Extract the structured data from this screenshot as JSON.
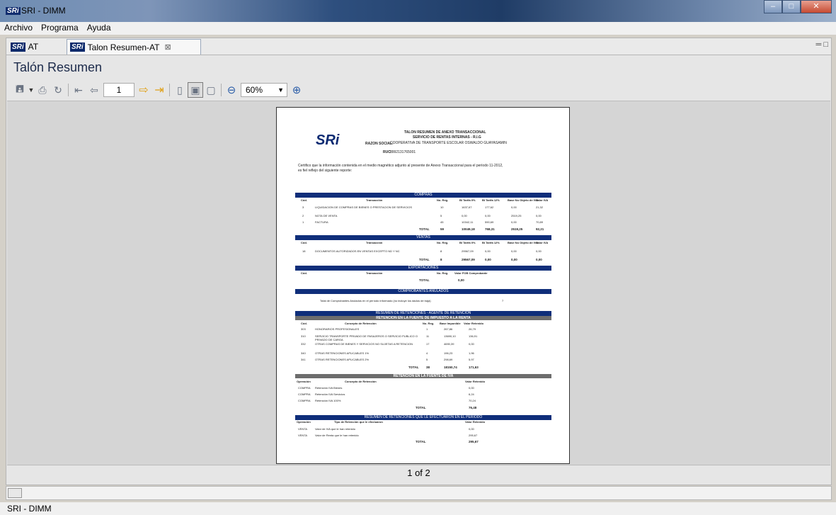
{
  "window": {
    "app_logo": "SRi",
    "title": "SRI - DIMM"
  },
  "menu": [
    "Archivo",
    "Programa",
    "Ayuda"
  ],
  "tabs": [
    {
      "badge": "SRi",
      "label": "AT"
    },
    {
      "badge": "SRi",
      "label": "Talon Resumen-AT",
      "close": "⊠"
    }
  ],
  "view": {
    "title": "Talón Resumen"
  },
  "toolbar": {
    "page_value": "1",
    "zoom_value": "60%"
  },
  "pager": "1 of 2",
  "status": "SRI - DIMM",
  "report": {
    "logo": "SRi",
    "h1": "TALON RESUMEN DE ANEXO TRANSACCIONAL",
    "h2": "SERVICIO DE RENTAS INTERNAS - R.I.G",
    "razon_label": "RAZON SOCIAL:",
    "razon": "COOPERATIVA DE TRANSPORTE ESCOLAR OSWALDO GUAYASAMIN",
    "ruc_label": "RUC:",
    "ruc": "0992131765001",
    "cert1": "Certifico que la información contenida en el medio magnético adjunto al presente de Anexo Transaccional para el período 11-2012,",
    "cert2": "es fiel reflejo del siguiente reporte:",
    "compras": {
      "title": "COMPRAS",
      "headers": [
        "Cód.",
        "Transacción",
        "No. Reg.",
        "BI Tarifa 0%",
        "BI Tarifa 12%",
        "Base No Objeto de IVA",
        "Valor IVA"
      ],
      "rows": [
        [
          "3",
          "LIQUIDACION DE COMPRAS DE BIENES O PRESTACION DE SERVICIOS",
          "10",
          "1637,67",
          "177,62",
          "0,00",
          "21,32"
        ],
        [
          "2",
          "NOTA DE VENTA",
          "5",
          "0,00",
          "0,00",
          "2519,25",
          "0,00"
        ],
        [
          "1",
          "FACTURA",
          "45",
          "10342,11",
          "590,69",
          "0,00",
          "70,89"
        ]
      ],
      "total": [
        "TOTAL",
        "59",
        "10049,18",
        "768,31",
        "2519,25",
        "92,21"
      ]
    },
    "ventas": {
      "title": "VENTAS",
      "headers": [
        "Cód.",
        "Transacción",
        "No. Reg.",
        "BI Tarifa 0%",
        "BI Tarifa 12%",
        "Base No Objeto de IVA",
        "Valor IVA"
      ],
      "rows": [
        [
          "18",
          "DOCUMENTOS AUTORIZADOS EN VENTAS EXCEPTO ND Y NC",
          "8",
          "29567,09",
          "0,00",
          "0,00",
          "0,00"
        ]
      ],
      "total": [
        "TOTAL",
        "8",
        "29567,09",
        "0,00",
        "0,00",
        "0,00"
      ]
    },
    "export": {
      "title": "EXPORTACIONES",
      "headers": [
        "Cód.",
        "Transacción",
        "No. Reg.",
        "Valor FOB Comprobante"
      ],
      "total": [
        "TOTAL",
        "0,00"
      ]
    },
    "anulados": {
      "title": "COMPROBANTES ANULADOS",
      "text": "Total de Comprobantes Anulados en el período informado (no incluye los dados de baja)",
      "value": "7"
    },
    "resumen_ret": "RESUMEN DE RETENCIONES - AGENTE DE RETENCION",
    "ret_renta": {
      "title": "RETENCION EN LA FUENTE DE IMPUESTO A LA RENTA",
      "headers": [
        "Cód.",
        "Concepto de Retención",
        "No. Reg.",
        "Base Imponible",
        "Valor Retenido"
      ],
      "rows": [
        [
          "303",
          "HONORARIOS PROFESIONALES",
          "1",
          "267,86",
          "26,79"
        ],
        [
          "310",
          "SERVICIO TRANSPORTE PRIVADO DE PASAJEROS O SERVICIO PUBLICO O PRIVADO DE CARGA",
          "11",
          "13690,10",
          "136,91"
        ],
        [
          "332",
          "OTRAS COMPRAS DE BIENES Y SERVICIOS NO SUJETAS A RETENCION",
          "17",
          "4690,39",
          "0,00"
        ],
        [
          "340",
          "OTRAS RETENCIONES APLICABLES 1%",
          "4",
          "196,23",
          "1,96"
        ],
        [
          "341",
          "OTRAS RETENCIONES APLICABLES 2%",
          "5",
          "298,69",
          "5,97"
        ]
      ],
      "total": [
        "TOTAL",
        "38",
        "18150,74",
        "171,63"
      ]
    },
    "ret_iva": {
      "title": "RETENCION EN LA FUENTE DE IVA",
      "headers": [
        "Operación",
        "Concepto de Retención",
        "Valor Retenido"
      ],
      "rows": [
        [
          "COMPRA",
          "Retención IVA Bienes",
          "0,00"
        ],
        [
          "COMPRA",
          "Retención IVA Servicios",
          "6,24"
        ],
        [
          "COMPRA",
          "Retención IVA 100%",
          "70,24"
        ]
      ],
      "total": [
        "TOTAL",
        "76,48"
      ]
    },
    "ret_efect": {
      "title": "RESUMEN DE RETENCIONES QUE LE EFECTUARON EN EL PERIODO",
      "headers": [
        "Operación",
        "Tipo de Retención que le efectuaron",
        "Valor Retenido"
      ],
      "rows": [
        [
          "VENTA",
          "Valor de IVA que le han retenido",
          "0,00"
        ],
        [
          "VENTA",
          "Valor de Renta que le han retenido",
          "295,67"
        ]
      ],
      "total": [
        "TOTAL",
        "295,67"
      ]
    }
  }
}
